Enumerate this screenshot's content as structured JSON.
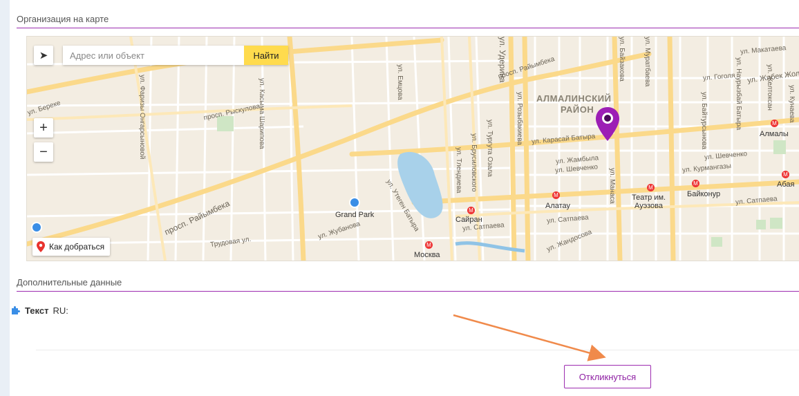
{
  "sections": {
    "map_title": "Организация на карте",
    "extra_title": "Дополнительные данные"
  },
  "map": {
    "search_placeholder": "Адрес или объект",
    "search_button": "Найти",
    "zoom_in": "+",
    "zoom_out": "−",
    "route_label": "Как добраться",
    "district_line1": "АЛМАЛИНСКИЙ",
    "district_line2": "РАЙОН",
    "labels": {
      "rayimbek_top": "просп. Райымбека",
      "rayimbek_left": "просп. Райымбека",
      "ryskulov": "просп. Рыскулова",
      "karasai": "ул. Карасай Батыра",
      "zhambyl": "ул. Жамбыла",
      "shevchenko_left": "ул. Шевченко",
      "shevchenko_right": "ул. Шевченко",
      "kurmangazy": "ул. Курмангазы",
      "satpaev_left": "ул. Сатпаева",
      "satpaev_mid": "ул. Сатпаева",
      "satpaev_right": "ул. Сатпаева",
      "gogol": "ул. Гоголя",
      "makataev": "ул. Макатаева",
      "zhibek": "ул. Жибек Жолы",
      "zhubanova": "ул. Жубанова",
      "trudovaya": "Трудовая ул.",
      "zhandosov": "ул. Жандосова",
      "bereke": "ул. Береке",
      "grand_park": "Grand Park",
      "sayran": "Сайран",
      "alatau": "Алатау",
      "teatr1": "Театр им.",
      "teatr2": "Ауэзова",
      "baikonur": "Байконур",
      "moskva": "Москва",
      "almaly": "Алмалы",
      "abaya": "Абая",
      "farizy": "ул. Фаризы Онгарсыновой",
      "kasyma": "ул. Касыма Шарипова",
      "rozybakieva": "ул. Розыбакиева",
      "tlendieva": "ул. Тлендиева",
      "brusilovskogo": "ул. Брусиловского",
      "turguta": "ул. Тургута Озала",
      "utegen": "ул. Утеген Батыра",
      "manasa": "ул. Манаса",
      "baizakova": "ул. Байзакова",
      "muratbaeva": "ул. Муратбаева",
      "baitursynova": "ул. Байтурсынова",
      "emtsova": "ул. Емцова",
      "kunaeva": "ул. Кунаева",
      "zheltoksan": "ул. Желтоксан",
      "naurizbai": "ул. Наурызбай Батыра",
      "udergina": "ул. Удерина"
    }
  },
  "extra": {
    "field_label": "Текст",
    "field_suffix": "RU:"
  },
  "actions": {
    "respond_label": "Откликнуться"
  },
  "colors": {
    "accent": "#9c2bb0",
    "search_button": "#ffdb4d",
    "arrow": "#f08a4b"
  }
}
